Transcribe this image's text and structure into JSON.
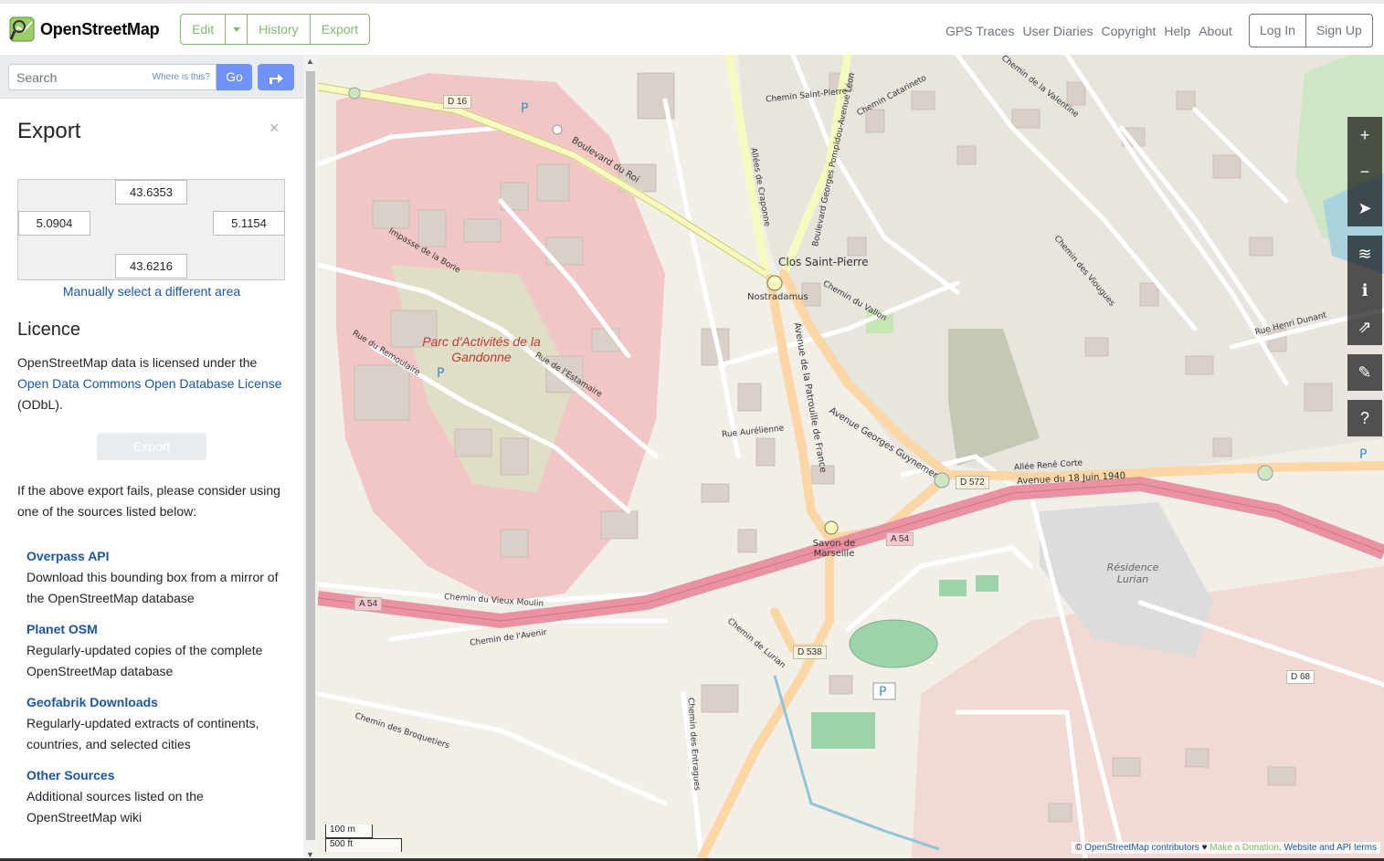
{
  "header": {
    "brand": "OpenStreetMap",
    "edit_label": "Edit",
    "history_label": "History",
    "export_label": "Export",
    "nav": [
      "GPS Traces",
      "User Diaries",
      "Copyright",
      "Help",
      "About"
    ],
    "login_label": "Log In",
    "signup_label": "Sign Up"
  },
  "search": {
    "placeholder": "Search",
    "where_label": "Where is this?",
    "go_label": "Go"
  },
  "export_panel": {
    "title": "Export",
    "close_label": "×",
    "bbox": {
      "north": "43.6353",
      "west": "5.0904",
      "east": "5.1154",
      "south": "43.6216"
    },
    "manual_select": "Manually select a different area",
    "licence_title": "Licence",
    "licence_intro": "OpenStreetMap data is licensed under the",
    "licence_link": "Open Data Commons Open Database License",
    "licence_suffix": "(ODbL).",
    "export_button": "Export",
    "fail_text": "If the above export fails, please consider using one of the sources listed below:",
    "sources": [
      {
        "title": "Overpass API",
        "desc": "Download this bounding box from a mirror of the OpenStreetMap database"
      },
      {
        "title": "Planet OSM",
        "desc": "Regularly-updated copies of the complete OpenStreetMap database"
      },
      {
        "title": "Geofabrik Downloads",
        "desc": "Regularly-updated extracts of continents, countries, and selected cities"
      },
      {
        "title": "Other Sources",
        "desc": "Additional sources listed on the OpenStreetMap wiki"
      }
    ]
  },
  "map": {
    "labels": {
      "park": "Parc d'Activités de la Gandonne",
      "clos": "Clos Saint-Pierre",
      "nostradamus": "Nostradamus",
      "savon": "Savon de Marseille",
      "residence": "Résidence Lurian",
      "bd_du_roi": "Boulevard du Roi",
      "av_18juin": "Avenue du 18 Juin 1940",
      "av_guynemer": "Avenue Georges Guynemer",
      "av_patrouille": "Avenue de la Patrouille de France",
      "allee_rene": "Allée René Corte",
      "chemin_vieux": "Chemin du Vieux Moulin",
      "chemin_avenir": "Chemin de l'Avenir",
      "chemin_broquetiers": "Chemin des Broquetiers",
      "rue_remoulaire": "Rue du Remoulaire",
      "rue_estamaire": "Rue de l'Estamaire",
      "allees_craponne": "Allées de Craponne",
      "chemin_vallon": "Chemin du Vallon",
      "bd_pompidou": "Boulevard Georges Pompidou-Avenue Léon",
      "chemin_lurian": "Chemin de Lurian",
      "chemin_entragues": "Chemin des Entragues",
      "rue_aurelienne": "Rue Aurélienne",
      "impasse_borie": "Impasse de la Borie",
      "chemin_valentine": "Chemin de la Valentine",
      "chemin_catarineto": "Chemin Catarineto",
      "chemin_saint_pierre": "Chemin Saint-Pierre",
      "chemin_viougues": "Chemin des Viougues",
      "rue_henri": "Rue Henri Dunant"
    },
    "shields": {
      "d16": "D 16",
      "d572": "D 572",
      "a54a": "A 54",
      "a54b": "A 54",
      "d538": "D 538",
      "d68": "D 68"
    },
    "scale": {
      "metric": "100 m",
      "imperial": "500 ft"
    },
    "attribution": {
      "copyright": "© ",
      "contributors": "OpenStreetMap contributors",
      "heart": " ♥ ",
      "donate": "Make a Donation",
      "terms": ". Website and API terms"
    },
    "controls": [
      "zoom-in",
      "zoom-out",
      "locate",
      "layers",
      "legend",
      "share",
      "note",
      "query"
    ]
  },
  "colors": {
    "accent": "#7ebc6f",
    "go": "#7092ff",
    "link": "#1a55a8"
  }
}
